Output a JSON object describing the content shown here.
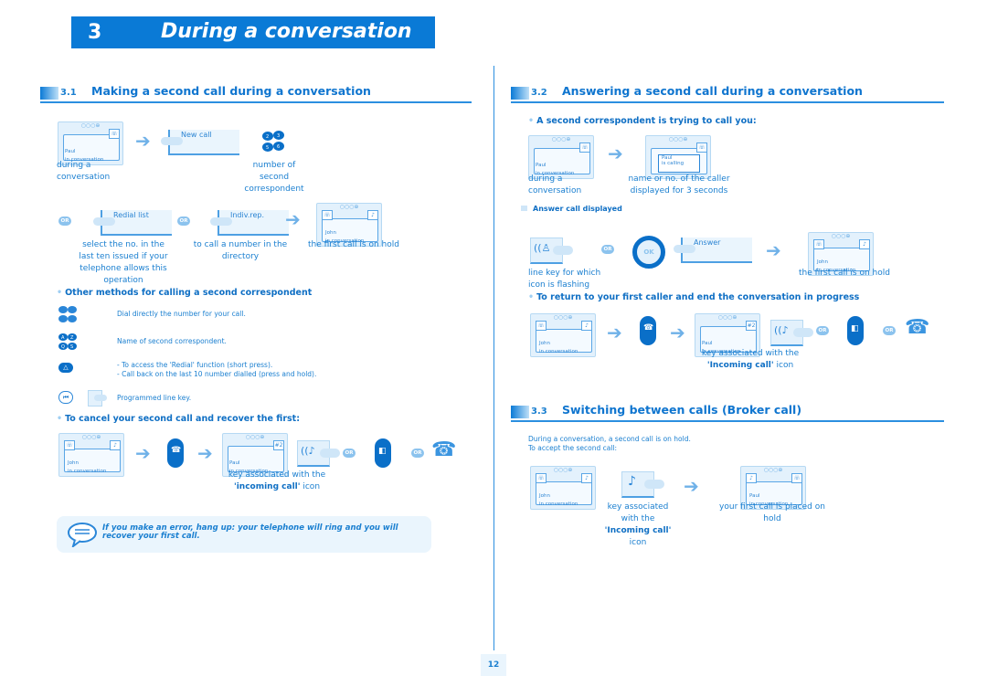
{
  "chapter": {
    "number": "3",
    "title": "During a conversation"
  },
  "colors": {
    "accent": "#0a7ad6",
    "text": "#1a7fd0",
    "light_bg": "#eaf5fd"
  },
  "s31": {
    "number": "3.1",
    "title": "Making a second call during a conversation",
    "screen1": {
      "line1": "Paul",
      "line2": "in conversation"
    },
    "softkey_new": "New call",
    "cap_during": [
      "during a",
      "conversation"
    ],
    "cap_number": [
      "number of",
      "second",
      "correspondent"
    ],
    "or": "OR",
    "softkey_redial": "Redial list",
    "softkey_indiv": "Indiv.rep.",
    "screen2": {
      "line1": "John",
      "line2": "in conversation"
    },
    "cap_redial": [
      "select the no. in the",
      "last ten issued if your",
      "telephone allows this",
      "operation"
    ],
    "cap_indiv": [
      "to call a number in the",
      "directory"
    ],
    "cap_hold": "the first call is on hold",
    "other_heading": "Other methods for calling a second correspondent",
    "methods": [
      {
        "icon": "numeric-keypad-icon",
        "text": "Dial directly the number for your call."
      },
      {
        "icon": "alpha-keypad-icon",
        "text": "Name of second correspondent."
      },
      {
        "icon": "redial-key-icon",
        "text": "- To access the 'Redial' function (short press).",
        "text2": "- Call back on the last 10 number dialled (press and hold)."
      },
      {
        "icon": "programmed-line-key-icon",
        "text": "Programmed line key."
      }
    ],
    "cancel_heading": "To cancel your second call and recover the first:",
    "screen3": {
      "line1": "John",
      "line2": "in conversation"
    },
    "screen4": {
      "line1": "Paul",
      "line2": "in conversation",
      "badge": "#2"
    },
    "cap_key_assoc": "key associated with the",
    "cap_incoming_bold": "'incoming call'",
    "cap_incoming_rest": " icon",
    "note": "If you make an error, hang up: your telephone will ring and you will recover your first call."
  },
  "s32": {
    "number": "3.2",
    "title": "Answering a second call during a conversation",
    "heading1": "A second correspondent is trying to call you:",
    "screen1": {
      "line1": "Paul",
      "line2": "in conversation"
    },
    "screen2": {
      "line1": "Paul",
      "line2": "is calling"
    },
    "cap_during": [
      "during a",
      "conversation"
    ],
    "cap_caller": [
      "name or no. of the caller",
      "displayed for 3 seconds"
    ],
    "answer_heading": "Answer call displayed",
    "ok": "OK",
    "or": "OR",
    "softkey_answer": "Answer",
    "screen3": {
      "line1": "John",
      "line2": "in conversation"
    },
    "cap_linekey": [
      "line key for which",
      "icon is flashing"
    ],
    "cap_hold": "the first call is on hold",
    "return_heading": "To return to your first caller and end the conversation in progress",
    "screen4": {
      "line1": "John",
      "line2": "in conversation"
    },
    "screen5": {
      "line1": "Paul",
      "line2": "in conversation",
      "badge": "#2"
    },
    "cap_key_assoc": "key associated with the",
    "cap_incoming_bold": "'Incoming call'",
    "cap_incoming_rest": " icon"
  },
  "s33": {
    "number": "3.3",
    "title": "Switching between calls (Broker call)",
    "intro1": "During a conversation, a second call is on hold.",
    "intro2": "To accept the second call:",
    "screen1": {
      "line1": "John",
      "line2": "in conversation"
    },
    "screen2": {
      "line1": "Paul",
      "line2": "in conversation"
    },
    "cap_key": [
      "key associated",
      "with the"
    ],
    "cap_incoming_bold": "'Incoming call'",
    "cap_icon": "icon",
    "cap_placed": [
      "your first call is placed on",
      "hold"
    ]
  },
  "page_number": "12"
}
